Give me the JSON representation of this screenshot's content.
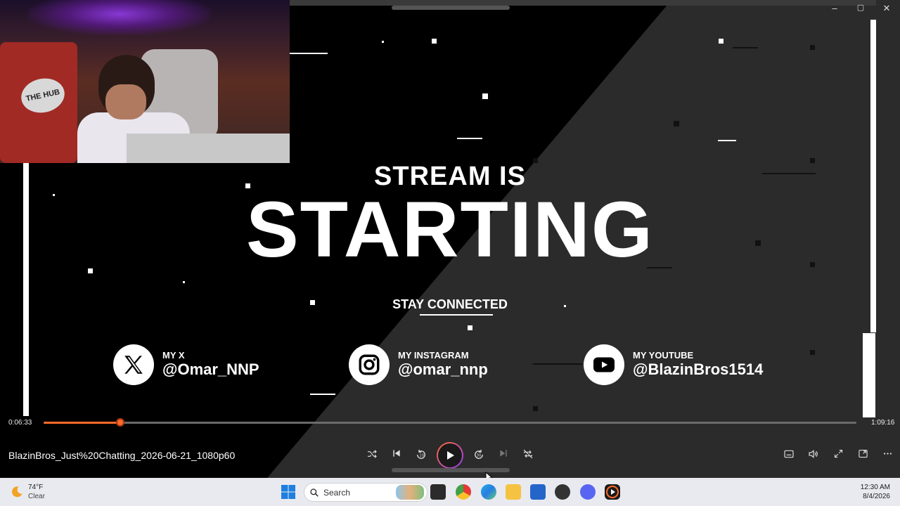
{
  "window": {
    "controls": [
      "–",
      "▢",
      "✕"
    ]
  },
  "overlay": {
    "stream_is": "STREAM IS",
    "starting": "STARTING",
    "stay_connected": "STAY CONNECTED",
    "socials": [
      {
        "label": "MY X",
        "handle": "@Omar_NNP",
        "icon": "x-logo-icon"
      },
      {
        "label": "MY INSTAGRAM",
        "handle": "@omar_nnp",
        "icon": "instagram-icon"
      },
      {
        "label": "MY YOUTUBE",
        "handle": "@BlazinBros1514",
        "icon": "youtube-icon"
      }
    ]
  },
  "webcam": {
    "logo_text": "THE HUB"
  },
  "player": {
    "elapsed": "0:06:33",
    "duration": "1:09:16",
    "progress_fraction": 0.0946,
    "filename": "BlazinBros_Just%20Chatting_2026-06-21_1080p60",
    "accent": "#ff6a2b"
  },
  "taskbar": {
    "temperature": "74°F",
    "condition": "Clear",
    "search_placeholder": "Search",
    "time": "12:30 AM",
    "date": "8/4/2026"
  }
}
